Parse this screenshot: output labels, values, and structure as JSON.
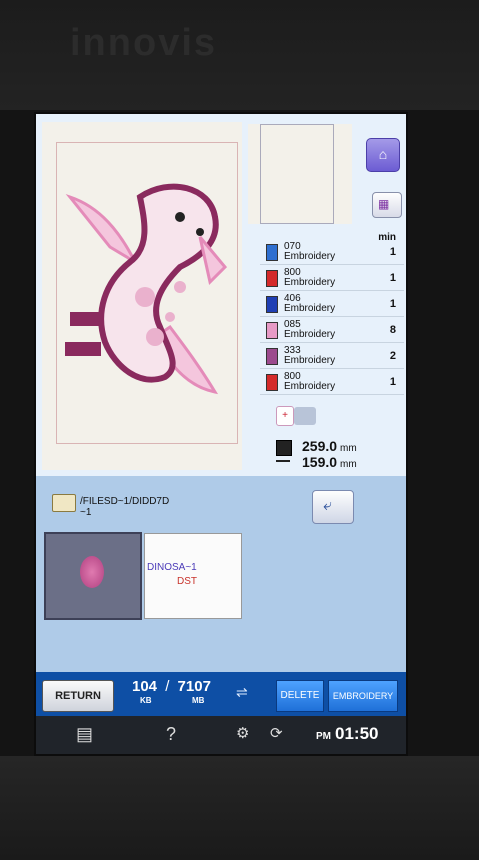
{
  "device": {
    "brand": "innovis"
  },
  "top_right": {
    "home_icon": "home-icon",
    "machine_icon": "machine-icon"
  },
  "threads": {
    "header": "min",
    "items": [
      {
        "code": "070",
        "name": "Embroidery",
        "min": "1",
        "color": "#2e6fd0"
      },
      {
        "code": "800",
        "name": "Embroidery",
        "min": "1",
        "color": "#d42a2a"
      },
      {
        "code": "406",
        "name": "Embroidery",
        "min": "1",
        "color": "#1f3fb4"
      },
      {
        "code": "085",
        "name": "Embroidery",
        "min": "8",
        "color": "#e79ac6"
      },
      {
        "code": "333",
        "name": "Embroidery",
        "min": "2",
        "color": "#9c4a8e"
      },
      {
        "code": "800",
        "name": "Embroidery",
        "min": "1",
        "color": "#d42a2a"
      }
    ]
  },
  "size": {
    "width": "259.0",
    "height": "159.0",
    "unit": "mm"
  },
  "browser": {
    "path": "/FILESD~1/DIDD7D",
    "path_tail": "~1",
    "file": {
      "name": "DINOSA~1",
      "type": "DST"
    }
  },
  "bottom": {
    "return_label": "RETURN",
    "used": "104",
    "used_unit": "KB",
    "total": "7107",
    "total_unit": "MB",
    "delete_label": "DELETE",
    "embroidery_label": "EMBROIDERY"
  },
  "status": {
    "help": "?",
    "ampm": "PM",
    "time": "01:50"
  }
}
